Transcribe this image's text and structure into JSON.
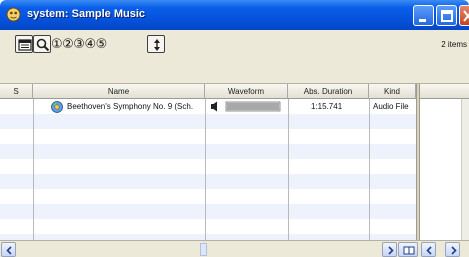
{
  "window": {
    "title": "system: Sample Music"
  },
  "toolbar": {
    "circled_numbers": "①②③④⑤",
    "items_count": "2 items"
  },
  "columns": {
    "s": "S",
    "name": "Name",
    "waveform": "Waveform",
    "duration": "Abs. Duration",
    "kind": "Kind"
  },
  "files": [
    {
      "name": "Beethoven's Symphony No. 9 (Sch.",
      "duration": "1:15.741",
      "kind": "Audio File"
    }
  ],
  "colors": {
    "titlebar": "#0553de",
    "row_alt": "#edf2fc",
    "chrome": "#ece9d8"
  },
  "icons": {
    "app": "app-icon",
    "browser_toggle": "browser-icon",
    "search": "magnifier-icon",
    "sort": "sort-arrows-icon",
    "speaker": "speaker-icon",
    "audio_file": "audio-file-icon"
  }
}
